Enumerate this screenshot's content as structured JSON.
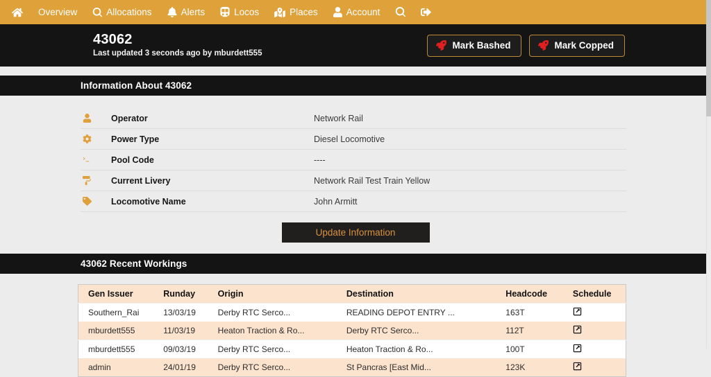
{
  "navbar": {
    "background": "#dfa139",
    "items": [
      {
        "label": "",
        "icon": "home-icon",
        "name": "nav-home"
      },
      {
        "label": "Overview",
        "icon": "",
        "name": "nav-overview"
      },
      {
        "label": "Allocations",
        "icon": "search-icon",
        "name": "nav-allocations"
      },
      {
        "label": "Alerts",
        "icon": "bell-icon",
        "name": "nav-alerts"
      },
      {
        "label": "Locos",
        "icon": "train-icon",
        "name": "nav-locos"
      },
      {
        "label": "Places",
        "icon": "map-marked-icon",
        "name": "nav-places"
      },
      {
        "label": "Account",
        "icon": "user-icon",
        "name": "nav-account"
      },
      {
        "label": "",
        "icon": "search-icon",
        "name": "nav-search"
      },
      {
        "label": "",
        "icon": "sign-out-icon",
        "name": "nav-logout"
      }
    ]
  },
  "header": {
    "title": "43062",
    "subtitle": "Last updated 3 seconds ago by mburdett555",
    "buttons": [
      {
        "label": "Mark Bashed",
        "icon": "rocket-icon",
        "accent": "#e02020"
      },
      {
        "label": "Mark Copped",
        "icon": "rocket-icon",
        "accent": "#e02020"
      }
    ],
    "button_border": "#c08a33"
  },
  "info_section": {
    "heading": "Information About 43062",
    "rows": [
      {
        "icon": "user-icon",
        "label": "Operator",
        "value": "Network Rail"
      },
      {
        "icon": "gear-icon",
        "label": "Power Type",
        "value": "Diesel Locomotive"
      },
      {
        "icon": "terminal-icon",
        "label": "Pool Code",
        "value": "----"
      },
      {
        "icon": "paint-roller-icon",
        "label": "Current Livery",
        "value": "Network Rail Test Train Yellow"
      },
      {
        "icon": "tag-icon",
        "label": "Locomotive Name",
        "value": "John Armitt"
      }
    ],
    "update_button": "Update Information"
  },
  "workings_section": {
    "heading": "43062 Recent Workings",
    "columns": [
      "Gen Issuer",
      "Runday",
      "Origin",
      "Destination",
      "Headcode",
      "Schedule"
    ],
    "rows": [
      {
        "gen_issuer": "Southern_Rai",
        "runday": "13/03/19",
        "origin": "Derby RTC Serco...",
        "destination": "READING DEPOT ENTRY ...",
        "headcode": "163T",
        "schedule_icon": "external-link-icon"
      },
      {
        "gen_issuer": "mburdett555",
        "runday": "11/03/19",
        "origin": "Heaton Traction & Ro...",
        "destination": "Derby RTC Serco...",
        "headcode": "112T",
        "schedule_icon": "external-link-icon"
      },
      {
        "gen_issuer": "mburdett555",
        "runday": "09/03/19",
        "origin": "Derby RTC Serco...",
        "destination": "Heaton Traction & Ro...",
        "headcode": "100T",
        "schedule_icon": "external-link-icon"
      },
      {
        "gen_issuer": "admin",
        "runday": "24/01/19",
        "origin": "Derby RTC Serco...",
        "destination": "St Pancras [East Mid...",
        "headcode": "123K",
        "schedule_icon": "external-link-icon"
      }
    ]
  },
  "colors": {
    "accent": "#dfa139",
    "dark": "#141414",
    "page_bg": "#ececec",
    "table_stripe": "#fce3cd"
  }
}
